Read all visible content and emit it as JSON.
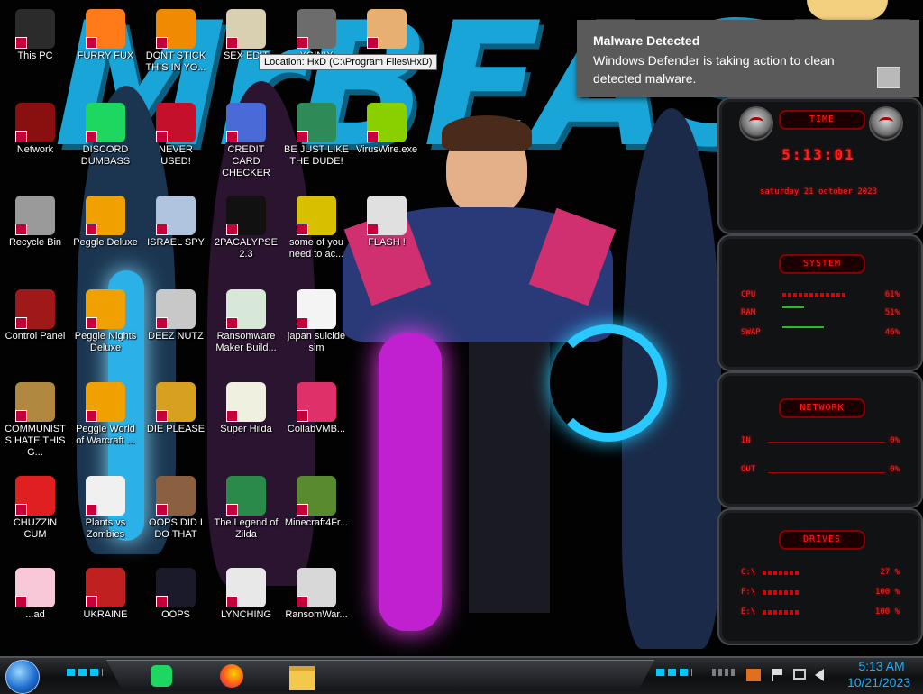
{
  "desktop": {
    "icons": [
      {
        "label": "This PC",
        "icon": "computer-icon",
        "color": "#2b2b2b"
      },
      {
        "label": "FURRY FUX",
        "icon": "firefox-icon",
        "color": "#ff7a18"
      },
      {
        "label": "DONT STICK THIS IN YO...",
        "icon": "vlc-cone-icon",
        "color": "#f08a00"
      },
      {
        "label": "SEX EDIT",
        "icon": "editor-icon",
        "color": "#d8d0b0"
      },
      {
        "label": "XGINIX",
        "icon": "hex-editor-icon",
        "color": "#6c6c6c"
      },
      {
        "label": "",
        "icon": "user-icon",
        "color": "#e8b070"
      },
      {
        "label": "Network",
        "icon": "network-icon",
        "color": "#8a1010"
      },
      {
        "label": "DISCORD DUMBASS",
        "icon": "spotify-icon",
        "color": "#1ed760"
      },
      {
        "label": "NEVER USED!",
        "icon": "dev-cpp-icon",
        "color": "#c4102a"
      },
      {
        "label": "CREDIT CARD CHECKER",
        "icon": "credit-card-icon",
        "color": "#4a6ad8"
      },
      {
        "label": "BE JUST LIKE THE DUDE!",
        "icon": "santa-icon",
        "color": "#2e8b57"
      },
      {
        "label": "VirusWire.exe",
        "icon": "lime-icon",
        "color": "#8ad000"
      },
      {
        "label": "Recycle Bin",
        "icon": "recycle-bin-icon",
        "color": "#9a9a9a"
      },
      {
        "label": "Peggle Deluxe",
        "icon": "peggle-icon",
        "color": "#f0a000"
      },
      {
        "label": "ISRAEL SPY",
        "icon": "spy-icon",
        "color": "#b0c4e0"
      },
      {
        "label": "2PACALYPSE 2.3",
        "icon": "console-icon",
        "color": "#111111"
      },
      {
        "label": "some of you need to ac...",
        "icon": "beaver-icon",
        "color": "#d8c000"
      },
      {
        "label": "FLASH !",
        "icon": "flash-icon",
        "color": "#e0e0e0"
      },
      {
        "label": "Control Panel",
        "icon": "control-panel-icon",
        "color": "#a01818"
      },
      {
        "label": "Peggle Nights Deluxe",
        "icon": "peggle-nights-icon",
        "color": "#f0a000"
      },
      {
        "label": "DEEZ NUTZ",
        "icon": "windows-stack-icon",
        "color": "#c8c8c8"
      },
      {
        "label": "Ransomware Maker Build...",
        "icon": "window-app-icon",
        "color": "#d8e8d8"
      },
      {
        "label": "japan suicide sim",
        "icon": "document-icon",
        "color": "#f4f4f4"
      },
      {
        "label": "COMMUNISTS HATE THIS G...",
        "icon": "money-bag-icon",
        "color": "#b08840"
      },
      {
        "label": "Peggle World of Warcraft ...",
        "icon": "peggle-wow-icon",
        "color": "#f0a000"
      },
      {
        "label": "DIE PLEASE",
        "icon": "dev-eco-icon",
        "color": "#d8a020"
      },
      {
        "label": "Super Hilda",
        "icon": "pixel-dog-icon",
        "color": "#f0f0e0"
      },
      {
        "label": "CollabVMB...",
        "icon": "collabvm-icon",
        "color": "#e0306a"
      },
      {
        "label": "CHUZZIN CUM",
        "icon": "chuzzle-icon",
        "color": "#e02020"
      },
      {
        "label": "Plants vs Zombies",
        "icon": "flower-icon",
        "color": "#f0f0f0"
      },
      {
        "label": "OOPS DID I DO THAT",
        "icon": "painting-icon",
        "color": "#8a6040"
      },
      {
        "label": "The Legend of Zilda",
        "icon": "pixel-hero-icon",
        "color": "#2a8a4a"
      },
      {
        "label": "Minecraft4Fr...",
        "icon": "minecraft-block-icon",
        "color": "#5a8a30"
      },
      {
        "label": "...ad",
        "icon": "star-butterfly-icon",
        "color": "#f8c8d8"
      },
      {
        "label": "UKRAINE",
        "icon": "radiation-icon",
        "color": "#c02020"
      },
      {
        "label": "OOPS",
        "icon": "oops-icon",
        "color": "#1a1a2a"
      },
      {
        "label": "LYNCHING",
        "icon": "lynching-icon",
        "color": "#e8e8e8"
      },
      {
        "label": "RansomWar...",
        "icon": "skull-icon",
        "color": "#d8d8d8"
      }
    ]
  },
  "tooltip": {
    "text": "Location: HxD (C:\\Program Files\\HxD)"
  },
  "notification": {
    "title": "Malware Detected",
    "body": "Windows Defender is taking action to clean detected malware.",
    "icon": "defender-icon"
  },
  "gadgets": {
    "time": {
      "header": "TIME",
      "time": "5:13:01",
      "date": "saturday 21 october 2023"
    },
    "system": {
      "header": "SYSTEM",
      "rows": [
        {
          "key": "CPU",
          "value": "61%"
        },
        {
          "key": "RAM",
          "value": "51%"
        },
        {
          "key": "SWAP",
          "value": "46%"
        }
      ]
    },
    "network": {
      "header": "NETWORK",
      "rows": [
        {
          "key": "IN",
          "value": "0%"
        },
        {
          "key": "OUT",
          "value": "0%"
        }
      ]
    },
    "drives": {
      "header": "DRIVES",
      "rows": [
        {
          "key": "C:\\",
          "value": "27 %"
        },
        {
          "key": "F:\\",
          "value": "100 %"
        },
        {
          "key": "E:\\",
          "value": "100 %"
        }
      ]
    }
  },
  "taskbar": {
    "start": "windows-orb-icon",
    "pinned": [
      {
        "name": "spotify-icon",
        "color": "#1ed760"
      },
      {
        "name": "firefox-icon",
        "color": "#ff7a18"
      },
      {
        "name": "file-explorer-icon",
        "color": "#f2c94c"
      }
    ],
    "tray": [
      "show-hidden-icon",
      "avast-icon",
      "flag-icon",
      "network-icon",
      "volume-icon"
    ],
    "clock": {
      "time": "5:13 AM",
      "date": "10/21/2023"
    }
  },
  "colors": {
    "accent_cyan": "#1aa5d8",
    "gadget_red": "#ff2020",
    "clock_blue": "#1ab0ff"
  },
  "wallpaper": {
    "text": "MrBEAST"
  }
}
